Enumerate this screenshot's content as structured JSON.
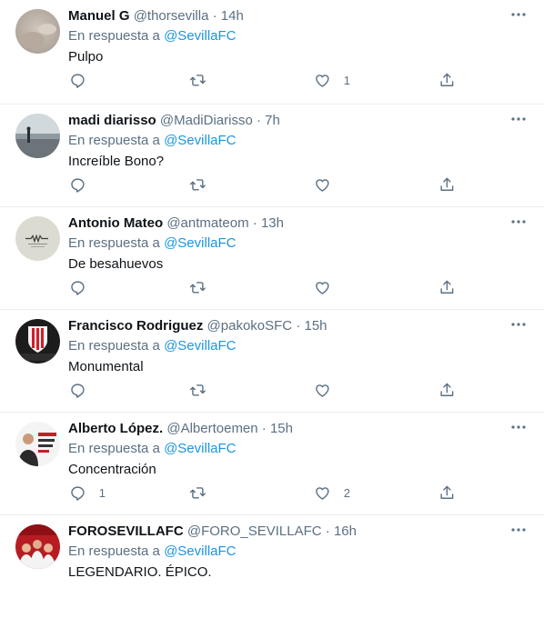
{
  "reply_prefix": "En respuesta a",
  "colors": {
    "link": "#1b95e0",
    "muted": "#5b7083",
    "text": "#0f1419",
    "divider": "#ebeef0"
  },
  "icons": {
    "more": "more-dots-icon",
    "reply": "reply-icon",
    "retweet": "retweet-icon",
    "like": "heart-icon",
    "share": "share-icon"
  },
  "tweets": [
    {
      "name": "Manuel G",
      "handle": "@thorsevilla",
      "time": "14h",
      "mention": "@SevillaFC",
      "text": "Pulpo",
      "replies": "",
      "retweets": "",
      "likes": "1"
    },
    {
      "name": "madi diarisso",
      "handle": "@MadiDiarisso",
      "time": "7h",
      "mention": "@SevillaFC",
      "text": "Increíble Bono?",
      "replies": "",
      "retweets": "",
      "likes": ""
    },
    {
      "name": "Antonio Mateo",
      "handle": "@antmateom",
      "time": "13h",
      "mention": "@SevillaFC",
      "text": "De besahuevos",
      "replies": "",
      "retweets": "",
      "likes": ""
    },
    {
      "name": "Francisco Rodriguez",
      "handle": "@pakokoSFC",
      "time": "15h",
      "mention": "@SevillaFC",
      "text": "Monumental",
      "replies": "",
      "retweets": "",
      "likes": ""
    },
    {
      "name": "Alberto López.",
      "handle": "@Albertoemen",
      "time": "15h",
      "mention": "@SevillaFC",
      "text": "Concentración",
      "replies": "1",
      "retweets": "",
      "likes": "2"
    },
    {
      "name": "FOROSEVILLAFC",
      "handle": "@FORO_SEVILLAFC",
      "time": "16h",
      "mention": "@SevillaFC",
      "text": "LEGENDARIO. ÉPICO.",
      "replies": "",
      "retweets": "",
      "likes": ""
    }
  ]
}
